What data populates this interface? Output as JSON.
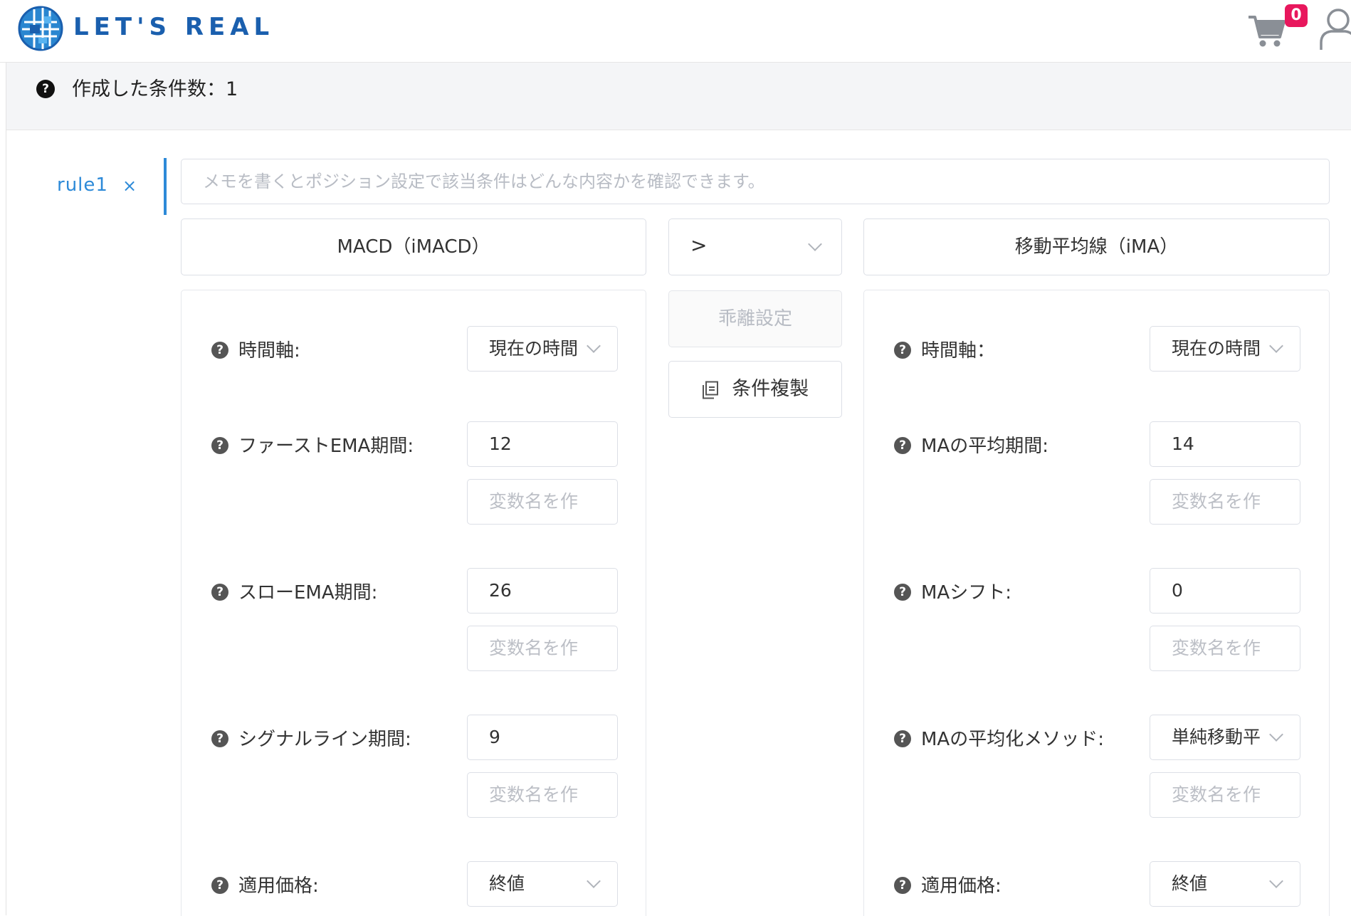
{
  "header": {
    "brand": "LET'S REAL",
    "cart_count": "0"
  },
  "summary": {
    "title": "作成した条件数：1"
  },
  "rule": {
    "tab_label": "rule1",
    "close_symbol": "×",
    "memo_placeholder": "メモを書くとポジション設定で該当条件はどんな内容かを確認できます。"
  },
  "left_indicator": {
    "name": "MACD（iMACD）",
    "fields": [
      {
        "label": "時間軸:",
        "value": "現在の時間",
        "type": "select"
      },
      {
        "label": "ファーストEMA期間:",
        "value": "12",
        "var_placeholder": "変数名を作"
      },
      {
        "label": "スローEMA期間:",
        "value": "26",
        "var_placeholder": "変数名を作"
      },
      {
        "label": "シグナルライン期間:",
        "value": "9",
        "var_placeholder": "変数名を作"
      },
      {
        "label": "適用価格:",
        "value": "終値",
        "type": "select"
      }
    ]
  },
  "operator": {
    "value": ">",
    "deviation_label": "乖離設定",
    "duplicate_label": "条件複製"
  },
  "right_indicator": {
    "name": "移動平均線（iMA）",
    "fields": [
      {
        "label": "時間軸：",
        "value": "現在の時間",
        "type": "select"
      },
      {
        "label": "MAの平均期間:",
        "value": "14",
        "var_placeholder": "変数名を作"
      },
      {
        "label": "MAシフト:",
        "value": "0",
        "var_placeholder": "変数名を作"
      },
      {
        "label": "MAの平均化メソッド:",
        "value": "単純移動平",
        "type": "select",
        "var_placeholder": "変数名を作"
      },
      {
        "label": "適用価格:",
        "value": "終値",
        "type": "select"
      }
    ]
  },
  "colors": {
    "brand": "#1a5fae",
    "accent": "#2d8ad8",
    "badge": "#e8175d",
    "border": "#dcdfe6"
  },
  "icons": [
    "globe-logo-icon",
    "cart-icon",
    "user-icon",
    "help-icon",
    "close-icon",
    "chevron-down-icon",
    "copy-icon"
  ]
}
